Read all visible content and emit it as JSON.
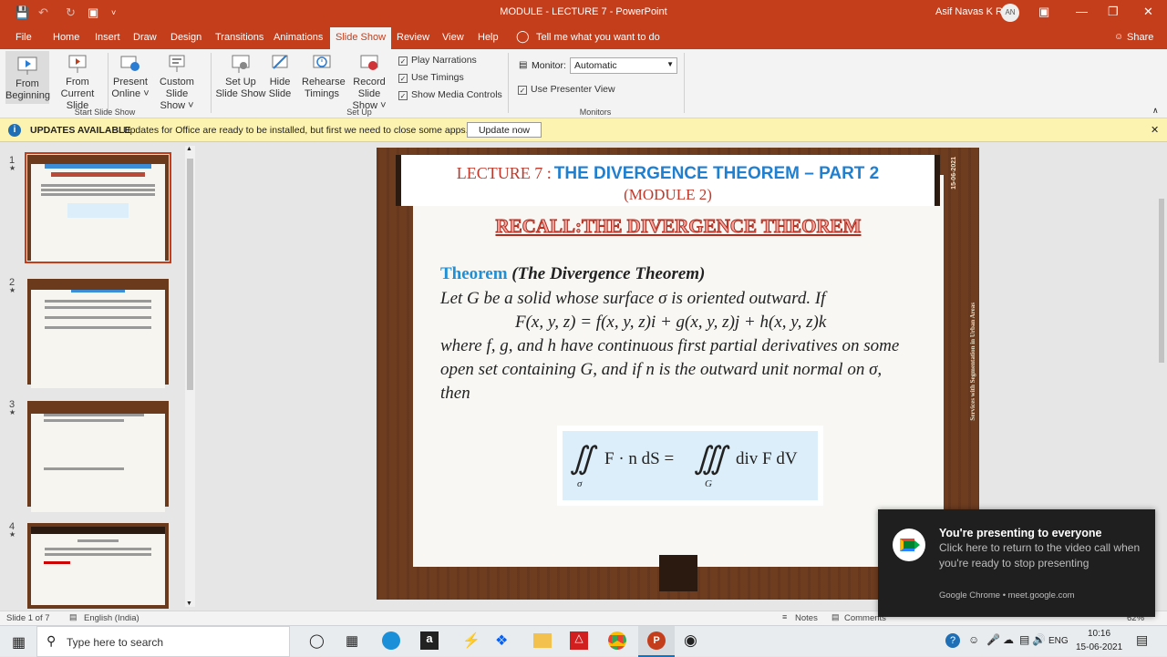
{
  "title_bar": {
    "window_title": "MODULE - LECTURE 7  -  PowerPoint",
    "user_name": "Asif Navas K R",
    "avatar_initials": "AN"
  },
  "tabs": [
    "File",
    "Home",
    "Insert",
    "Draw",
    "Design",
    "Transitions",
    "Animations",
    "Slide Show",
    "Review",
    "View",
    "Help"
  ],
  "tell_me": "Tell me what you want to do",
  "share": "Share",
  "ribbon": {
    "from_beginning": [
      "From",
      "Beginning"
    ],
    "from_current": [
      "From",
      "Current Slide"
    ],
    "present_online": [
      "Present",
      "Online ˅"
    ],
    "custom_show": [
      "Custom Slide",
      "Show ˅"
    ],
    "group_start": "Start Slide Show",
    "set_up_show": [
      "Set Up",
      "Slide Show"
    ],
    "hide_slide": [
      "Hide",
      "Slide"
    ],
    "rehearse": [
      "Rehearse",
      "Timings"
    ],
    "record": [
      "Record Slide",
      "Show ˅"
    ],
    "play_narrations": "Play Narrations",
    "use_timings": "Use Timings",
    "show_media_controls": "Show Media Controls",
    "group_setup": "Set Up",
    "monitor_label": "Monitor:",
    "monitor_value": "Automatic",
    "use_presenter_view": "Use Presenter View",
    "group_monitors": "Monitors"
  },
  "message_bar": {
    "title": "UPDATES AVAILABLE",
    "text": "Updates for Office are ready to be installed, but first we need to close some apps.",
    "button": "Update now"
  },
  "thumbnails": [
    {
      "num": "1",
      "star": "★"
    },
    {
      "num": "2",
      "star": "★"
    },
    {
      "num": "3",
      "star": "★"
    },
    {
      "num": "4",
      "star": "★"
    }
  ],
  "slide": {
    "lecture_prefix": "LECTURE 7 :",
    "lecture_title": "THE DIVERGENCE THEOREM – PART 2",
    "module": "(MODULE 2)",
    "date_vertical": "15-06-2021",
    "side_vertical": "Services with Segmentation in Urban Areas",
    "recall": "RECALL:THE DIVERGENCE THEOREM",
    "theorem_word": "Theorem",
    "theorem_name": "(The Divergence Theorem)",
    "line1": "Let G be a solid whose surface σ is oriented outward. If",
    "line2": "F(x, y, z) = f(x, y, z)i + g(x, y, z)j + h(x, y, z)k",
    "line3": "where f, g, and h have continuous first partial derivatives on some",
    "line4": "open set containing G, and if n is the outward unit normal on σ,",
    "line5": "then",
    "formula_left": "F · n dS =",
    "formula_right": "div F dV",
    "sub_sigma": "σ",
    "sub_G": "G"
  },
  "status_bar": {
    "slide_of": "Slide 1 of 7",
    "language": "English (India)",
    "notes": "Notes",
    "comments": "Comments",
    "zoom": "62%"
  },
  "taskbar": {
    "search_placeholder": "Type here to search",
    "lang": "ENG",
    "time": "10:16",
    "date": "15-06-2021"
  },
  "toast": {
    "title": "You're presenting to everyone",
    "body": "Click here to return to the video call when you're ready to stop presenting",
    "footer": "Google Chrome • meet.google.com"
  }
}
